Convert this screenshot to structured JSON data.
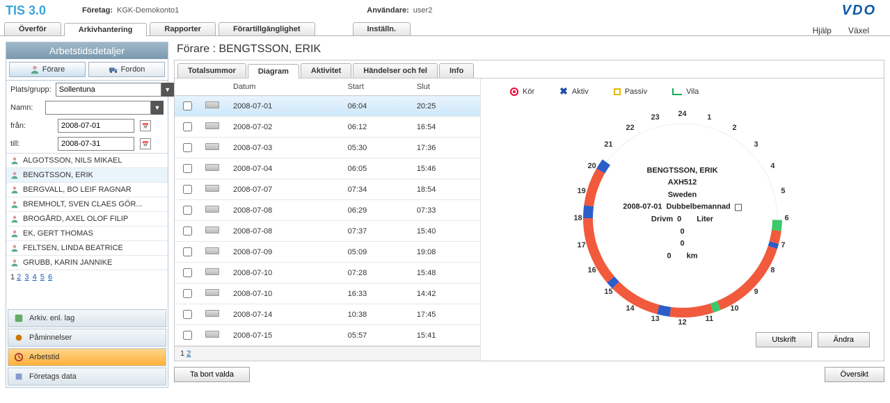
{
  "app": {
    "title": "TIS 3.0"
  },
  "header": {
    "company_label": "Företag:",
    "company_value": "KGK-Demokonto1",
    "user_label": "Användare:",
    "user_value": "user2",
    "logo": "VDO"
  },
  "main_tabs": {
    "transfer": "Överför",
    "archive": "Arkivhantering",
    "reports": "Rapporter",
    "availability": "Förartillgänglighet",
    "settings": "Inställn."
  },
  "right_links": {
    "help": "Hjälp",
    "switch": "Växel"
  },
  "left_panel": {
    "title": "Arbetstidsdetaljer",
    "tab_driver": "Förare",
    "tab_vehicle": "Fordon",
    "plats_label": "Plats/grupp:",
    "plats_value": "Sollentuna",
    "name_label": "Namn:",
    "name_value": "",
    "from_label": "från:",
    "from_value": "2008-07-01",
    "to_label": "till:",
    "to_value": "2008-07-31",
    "drivers": [
      "ALGOTSSON, NILS MIKAEL",
      "BENGTSSON, ERIK",
      "BERGVALL, BO LEIF RAGNAR",
      "BREMHOLT, SVEN CLAES GÖR...",
      "BROGÅRD, AXEL OLOF FILIP",
      "EK, GERT THOMAS",
      "FELTSEN, LINDA BEATRICE",
      "GRUBB, KARIN JANNIKE"
    ],
    "selected_driver_index": 1,
    "pager": [
      "1",
      "2",
      "3",
      "4",
      "5",
      "6"
    ],
    "pager_current": 0,
    "menu": {
      "arkiv": "Arkiv. enl. lag",
      "pamin": "Påminnelser",
      "arbetstid": "Arbetstid",
      "foretag": "Företags data"
    }
  },
  "main": {
    "title": "Förare : BENGTSSON, ERIK",
    "tabs": {
      "totals": "Totalsummor",
      "diagram": "Diagram",
      "activity": "Aktivitet",
      "events": "Händelser och fel",
      "info": "Info"
    },
    "grid": {
      "col_date": "Datum",
      "col_start": "Start",
      "col_end": "Slut",
      "rows": [
        {
          "date": "2008-07-01",
          "start": "06:04",
          "end": "20:25"
        },
        {
          "date": "2008-07-02",
          "start": "06:12",
          "end": "16:54"
        },
        {
          "date": "2008-07-03",
          "start": "05:30",
          "end": "17:36"
        },
        {
          "date": "2008-07-04",
          "start": "06:05",
          "end": "15:46"
        },
        {
          "date": "2008-07-07",
          "start": "07:34",
          "end": "18:54"
        },
        {
          "date": "2008-07-08",
          "start": "06:29",
          "end": "07:33"
        },
        {
          "date": "2008-07-08",
          "start": "07:37",
          "end": "15:40"
        },
        {
          "date": "2008-07-09",
          "start": "05:09",
          "end": "19:08"
        },
        {
          "date": "2008-07-10",
          "start": "07:28",
          "end": "15:48"
        },
        {
          "date": "2008-07-10",
          "start": "16:33",
          "end": "14:42"
        },
        {
          "date": "2008-07-14",
          "start": "10:38",
          "end": "17:45"
        },
        {
          "date": "2008-07-15",
          "start": "05:57",
          "end": "15:41"
        }
      ],
      "selected_row": 0,
      "pager": [
        "1",
        "2"
      ],
      "pager_current": 0
    },
    "legend": {
      "drive": "Kör",
      "active": "Aktiv",
      "passive": "Passiv",
      "rest": "Vila"
    },
    "clock": {
      "name": "BENGTSSON, ERIK",
      "vehicle": "AXH512",
      "country": "Sweden",
      "date": "2008-07-01",
      "crew_label": "Dubbelbemannad",
      "drivm_label": "Drivm",
      "drivm_val": "0",
      "liter_label": "Liter",
      "v1": "0",
      "v2": "0",
      "v3": "0",
      "km_label": "km"
    },
    "buttons": {
      "print": "Utskrift",
      "change": "Ändra",
      "delete": "Ta bort valda",
      "overview": "Översikt"
    }
  }
}
